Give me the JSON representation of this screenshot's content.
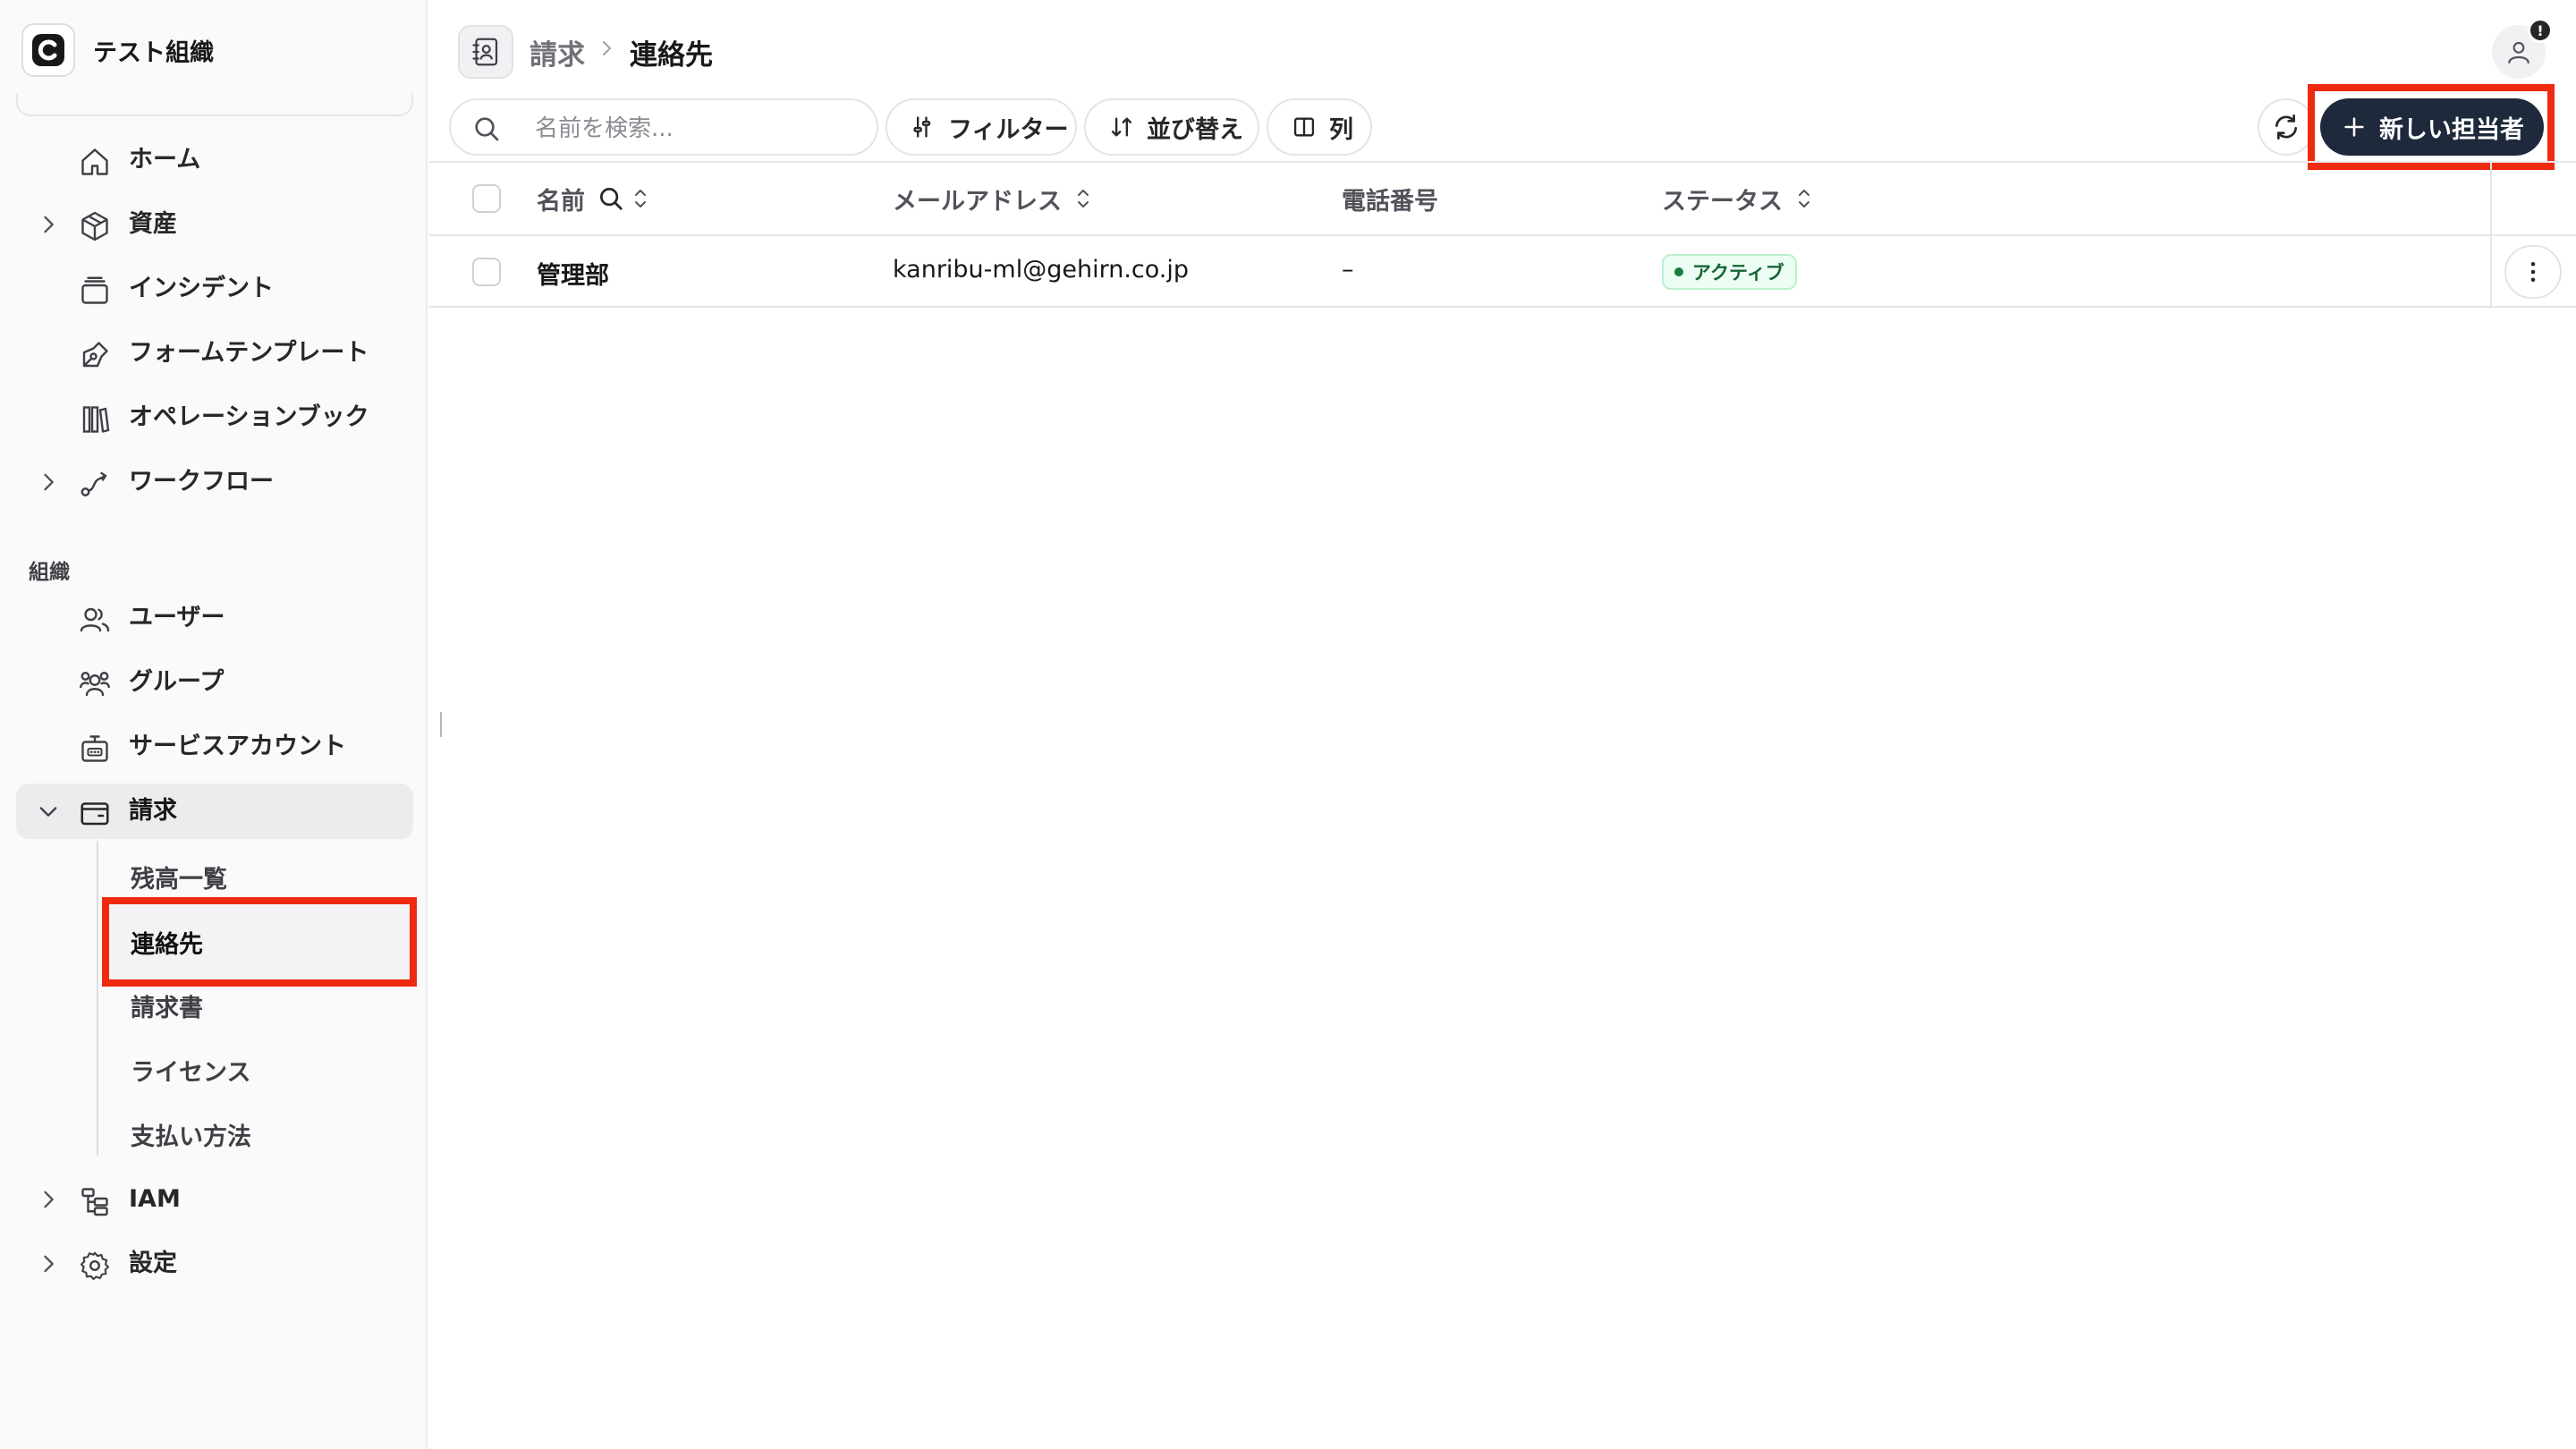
{
  "org": {
    "name": "テスト組織"
  },
  "nav": {
    "home": "ホーム",
    "assets": "資産",
    "incidents": "インシデント",
    "form_templates": "フォームテンプレート",
    "operation_book": "オペレーションブック",
    "workflow": "ワークフロー",
    "section_org": "組織",
    "users": "ユーザー",
    "groups": "グループ",
    "service_accounts": "サービスアカウント",
    "billing": "請求",
    "billing_sub": {
      "balance": "残高一覧",
      "contacts": "連絡先",
      "invoices": "請求書",
      "licenses": "ライセンス",
      "payment_methods": "支払い方法"
    },
    "iam": "IAM",
    "settings": "設定"
  },
  "breadcrumb": {
    "parent": "請求",
    "current": "連絡先"
  },
  "header": {
    "notification_badge": "!"
  },
  "toolbar": {
    "search_placeholder": "名前を検索...",
    "filter": "フィルター",
    "sort": "並び替え",
    "columns": "列",
    "new_contact": "新しい担当者"
  },
  "table": {
    "columns": {
      "name": "名前",
      "email": "メールアドレス",
      "phone": "電話番号",
      "status": "ステータス"
    },
    "rows": [
      {
        "name": "管理部",
        "email": "kanribu-ml@gehirn.co.jp",
        "phone": "–",
        "status": "アクティブ"
      }
    ]
  },
  "colors": {
    "accent_dark": "#1e293b",
    "highlight_red": "#ee2a10",
    "status_green": "#15803d"
  }
}
